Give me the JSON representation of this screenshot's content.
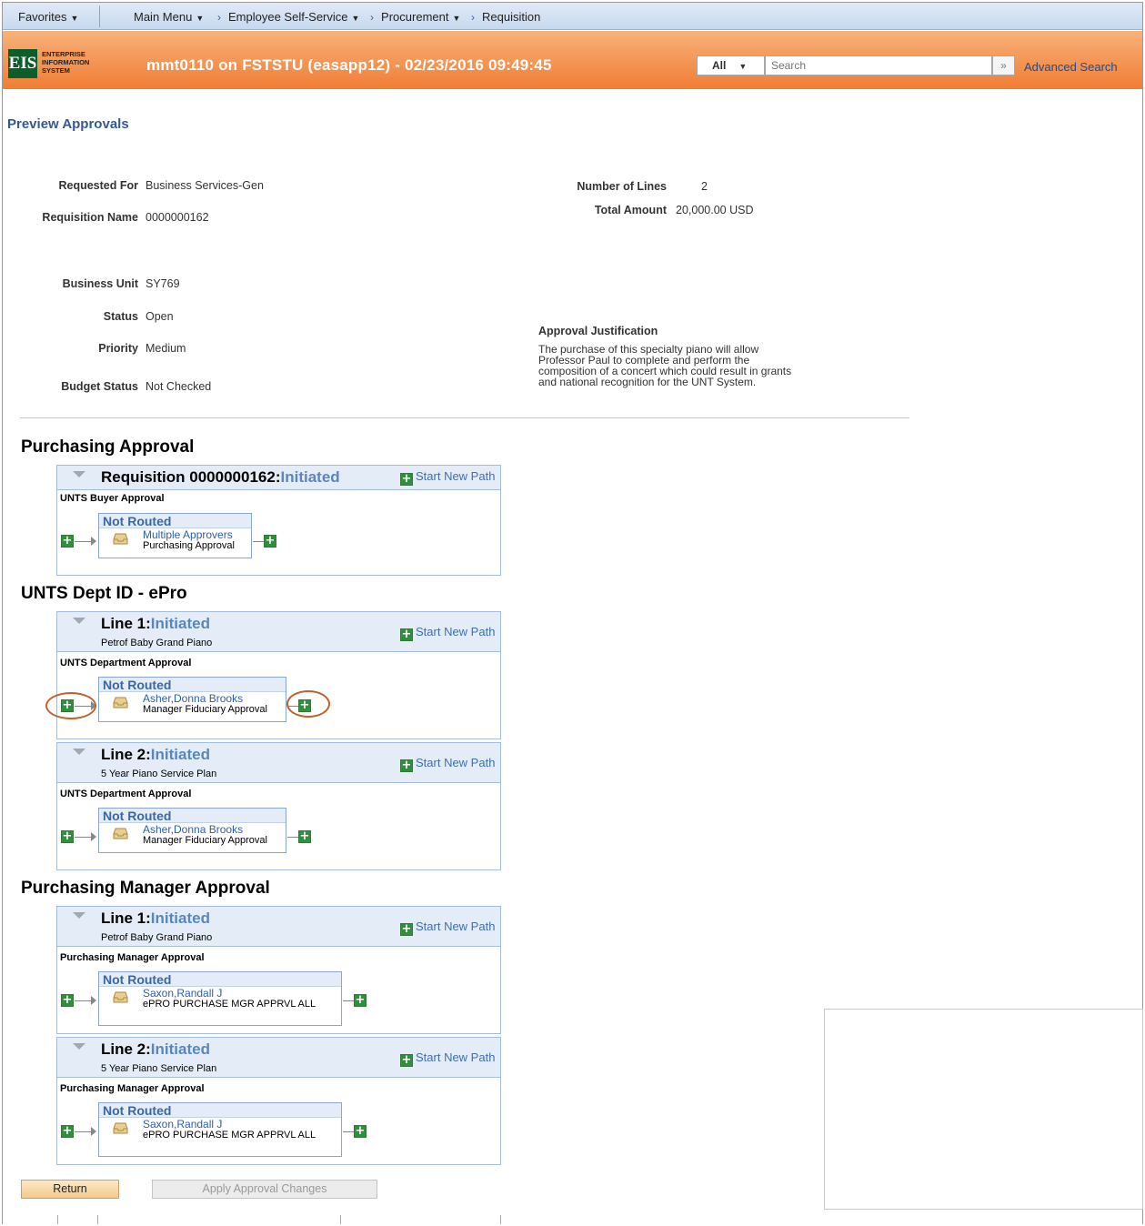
{
  "nav": {
    "favorites": "Favorites",
    "main_menu": "Main Menu",
    "breadcrumb": [
      "Employee Self-Service",
      "Procurement",
      "Requisition"
    ]
  },
  "header": {
    "logo_letters": "EIS",
    "logo_text": [
      "ENTERPRISE",
      "INFORMATION",
      "SYSTEM"
    ],
    "title": "mmt0110 on FSTSTU (easapp12) - 02/23/2016 09:49:45",
    "search_scope": "All",
    "search_placeholder": "Search",
    "advanced_search": "Advanced Search"
  },
  "page": {
    "title": "Preview Approvals"
  },
  "summary": {
    "requested_for_label": "Requested For",
    "requested_for": "Business Services-Gen",
    "req_name_label": "Requisition Name",
    "req_name": "0000000162",
    "num_lines_label": "Number of Lines",
    "num_lines": "2",
    "total_amount_label": "Total Amount",
    "total_amount": "20,000.00",
    "currency": "USD",
    "business_unit_label": "Business Unit",
    "business_unit": "SY769",
    "status_label": "Status",
    "status": "Open",
    "priority_label": "Priority",
    "priority": "Medium",
    "budget_status_label": "Budget Status",
    "budget_status": "Not Checked",
    "justification_label": "Approval Justification",
    "justification_lines": [
      "The purchase of this specialty piano will allow",
      "Professor Paul to complete and perform the",
      "composition of a concert which could result in grants",
      "and national recognition for the UNT System."
    ]
  },
  "common": {
    "start_new_path": "Start New Path",
    "not_routed": "Not Routed",
    "initiated": "Initiated"
  },
  "sections": [
    {
      "title": "Purchasing Approval",
      "boxes": [
        {
          "title": "Requisition 0000000162:",
          "sub": "",
          "step": "UNTS Buyer Approval",
          "approver": "Multiple Approvers",
          "role": "Purchasing Approval"
        }
      ]
    },
    {
      "title": "UNTS Dept ID - ePro",
      "boxes": [
        {
          "title": "Line 1:",
          "sub": "Petrof Baby Grand Piano",
          "step": "UNTS Department Approval",
          "approver": "Asher,Donna Brooks",
          "role": "Manager Fiduciary Approval"
        },
        {
          "title": "Line 2:",
          "sub": "5 Year Piano Service Plan",
          "step": "UNTS Department Approval",
          "approver": "Asher,Donna Brooks",
          "role": "Manager Fiduciary Approval"
        }
      ]
    },
    {
      "title": "Purchasing Manager Approval",
      "boxes": [
        {
          "title": "Line 1:",
          "sub": "Petrof Baby Grand Piano",
          "step": "Purchasing Manager Approval",
          "approver": "Saxon,Randall J",
          "role": "ePRO PURCHASE MGR APPRVL ALL"
        },
        {
          "title": "Line 2:",
          "sub": "5 Year Piano Service Plan",
          "step": "Purchasing Manager Approval",
          "approver": "Saxon,Randall J",
          "role": "ePRO PURCHASE MGR APPRVL ALL"
        }
      ]
    }
  ],
  "buttons": {
    "return": "Return",
    "apply": "Apply Approval Changes"
  }
}
